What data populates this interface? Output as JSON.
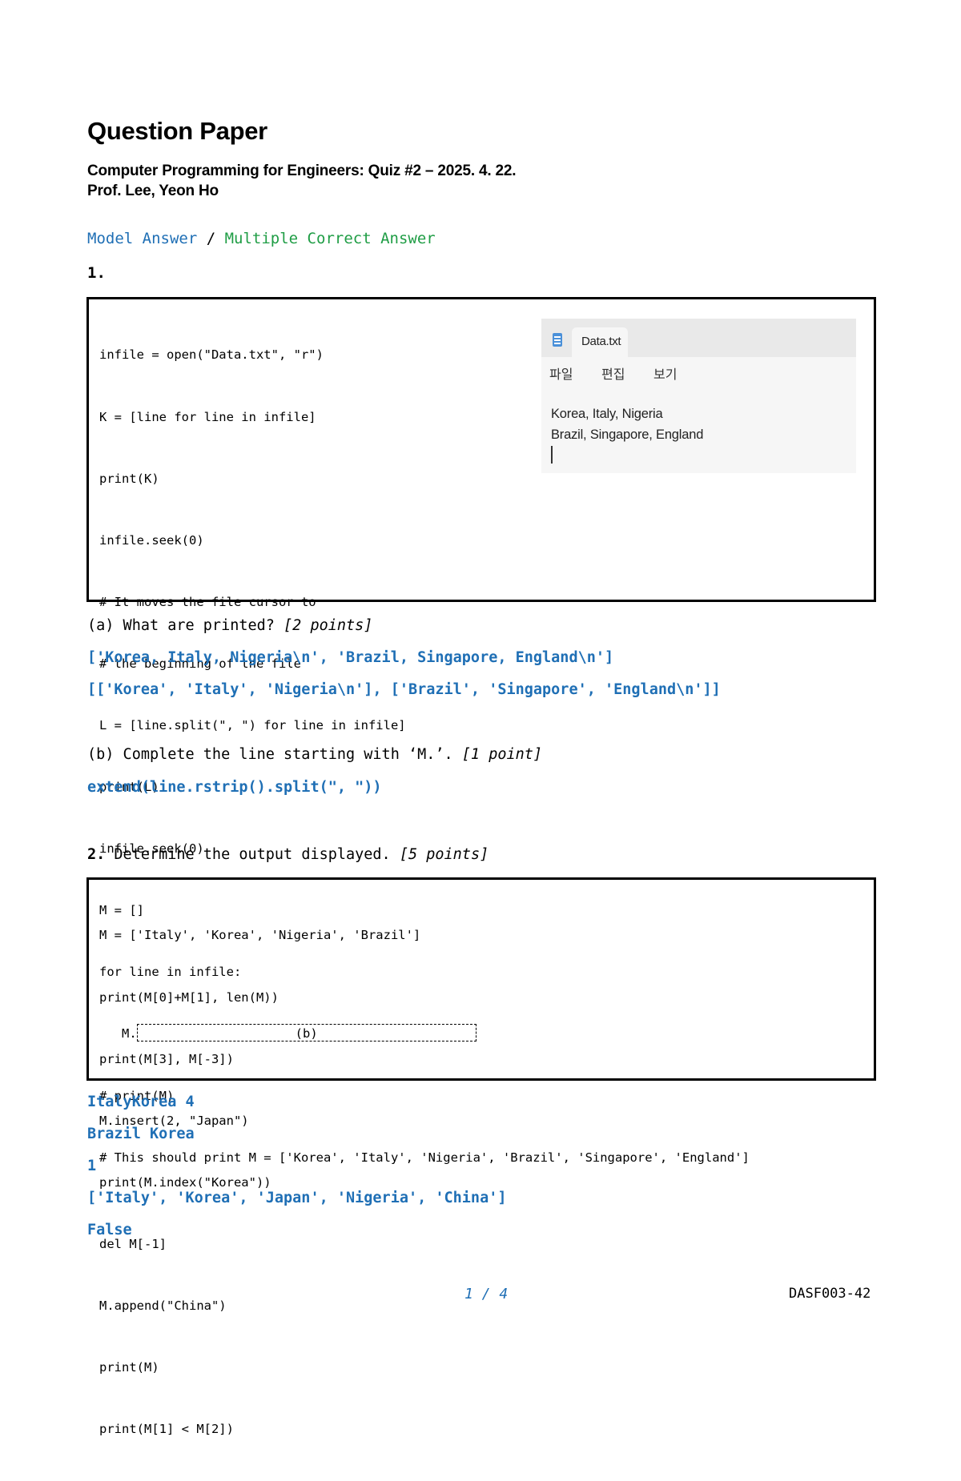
{
  "header": {
    "title": "Question Paper",
    "course_line": "Computer Programming for Engineers: Quiz #2 – 2025. 4. 22.",
    "professor": "Prof. Lee, Yeon Ho"
  },
  "legend": {
    "model_answer": "Model Answer",
    "separator": " / ",
    "multiple_answer": "Multiple Correct Answer",
    "colors": {
      "model": "#1f6fb5",
      "multiple": "#1f9d45"
    }
  },
  "q1": {
    "number": "1.",
    "code_lines": [
      "infile = open(\"Data.txt\", \"r\")",
      "K = [line for line in infile]",
      "print(K)",
      "infile.seek(0)",
      "# It moves the file cursor to",
      "# the beginning of the file",
      "L = [line.split(\", \") for line in infile]",
      "print(L)",
      "infile.seek(0)",
      "M = []",
      "for line in infile:"
    ],
    "blank_prefix": "   M.",
    "blank_label": "(b)",
    "code_tail": [
      "# print(M)",
      "# This should print M = ['Korea', 'Italy', 'Nigeria', 'Brazil', 'Singapore', 'England']"
    ],
    "notepad": {
      "tab_title": "Data.txt",
      "menu": [
        "파일",
        "편집",
        "보기"
      ],
      "lines": [
        "Korea, Italy, Nigeria",
        "Brazil, Singapore, England"
      ],
      "icon": "notepad-icon"
    },
    "a_question": "(a) What are printed? ",
    "a_points": "[2 points]",
    "a_answers": [
      "['Korea, Italy, Nigeria\\n', 'Brazil, Singapore, England\\n']",
      "[['Korea', 'Italy', 'Nigeria\\n'], ['Brazil', 'Singapore', 'England\\n']]"
    ],
    "b_question": "(b) Complete the line starting with ‘M.’. ",
    "b_points": "[1 point]",
    "b_answer": "extend(line.rstrip().split(\", \"))"
  },
  "q2": {
    "number": "2.",
    "question": " Determine the output displayed. ",
    "points": "[5 points]",
    "code_lines": [
      "M = ['Italy', 'Korea', 'Nigeria', 'Brazil']",
      "print(M[0]+M[1], len(M))",
      "print(M[3], M[-3])",
      "M.insert(2, \"Japan\")",
      "print(M.index(\"Korea\"))",
      "del M[-1]",
      "M.append(\"China\")",
      "print(M)",
      "print(M[1] < M[2])"
    ],
    "answers": [
      "ItalyKorea 4",
      "Brazil Korea",
      "1",
      "['Italy', 'Korea', 'Japan', 'Nigeria', 'China']",
      "False"
    ]
  },
  "footer": {
    "page": "1 / 4",
    "doc_code": "DASF003-42"
  }
}
